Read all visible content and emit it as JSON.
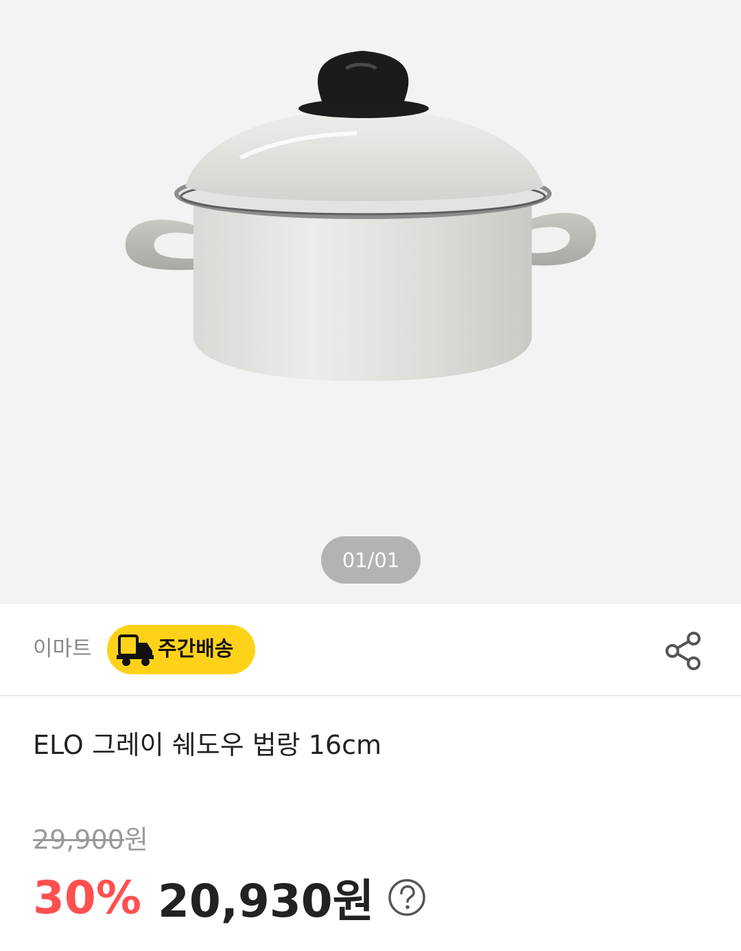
{
  "gallery": {
    "counter": "01/01"
  },
  "seller": {
    "name": "이마트",
    "delivery_badge": "주간배송"
  },
  "product": {
    "title": "ELO 그레이 쉐도우 법랑 16cm"
  },
  "price": {
    "original": "29,900",
    "original_unit": "원",
    "discount": "30%",
    "sale": "20,930원"
  },
  "colors": {
    "discount": "#ff5050",
    "badge": "#ffd21a"
  },
  "icons": {
    "share": "share-icon",
    "help": "question-circle-icon",
    "truck": "truck-icon"
  }
}
